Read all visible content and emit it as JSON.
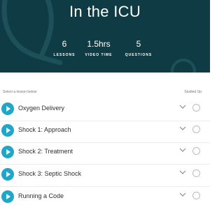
{
  "header": {
    "title": "In the ICU",
    "stats": [
      {
        "value": "6",
        "label": "LESSONS"
      },
      {
        "value": "1.5hrs",
        "label": "VIDEO TIME"
      },
      {
        "value": "5",
        "label": "QUESTIONS"
      }
    ]
  },
  "list": {
    "select_label": "Select a lesson below",
    "studied_label": "Studied Up",
    "lessons": [
      {
        "title": "Oxygen Delivery"
      },
      {
        "title": "Shock 1: Approach"
      },
      {
        "title": "Shock 2: Treatment"
      },
      {
        "title": "Shock 3: Septic Shock"
      },
      {
        "title": "Running a Code"
      }
    ]
  },
  "colors": {
    "hero_background": "#0f3c44",
    "play_button": "#1fa6c9"
  },
  "icons": {
    "play": "play-icon",
    "expand": "chevron-down-icon",
    "studied": "circle-outline-icon"
  }
}
